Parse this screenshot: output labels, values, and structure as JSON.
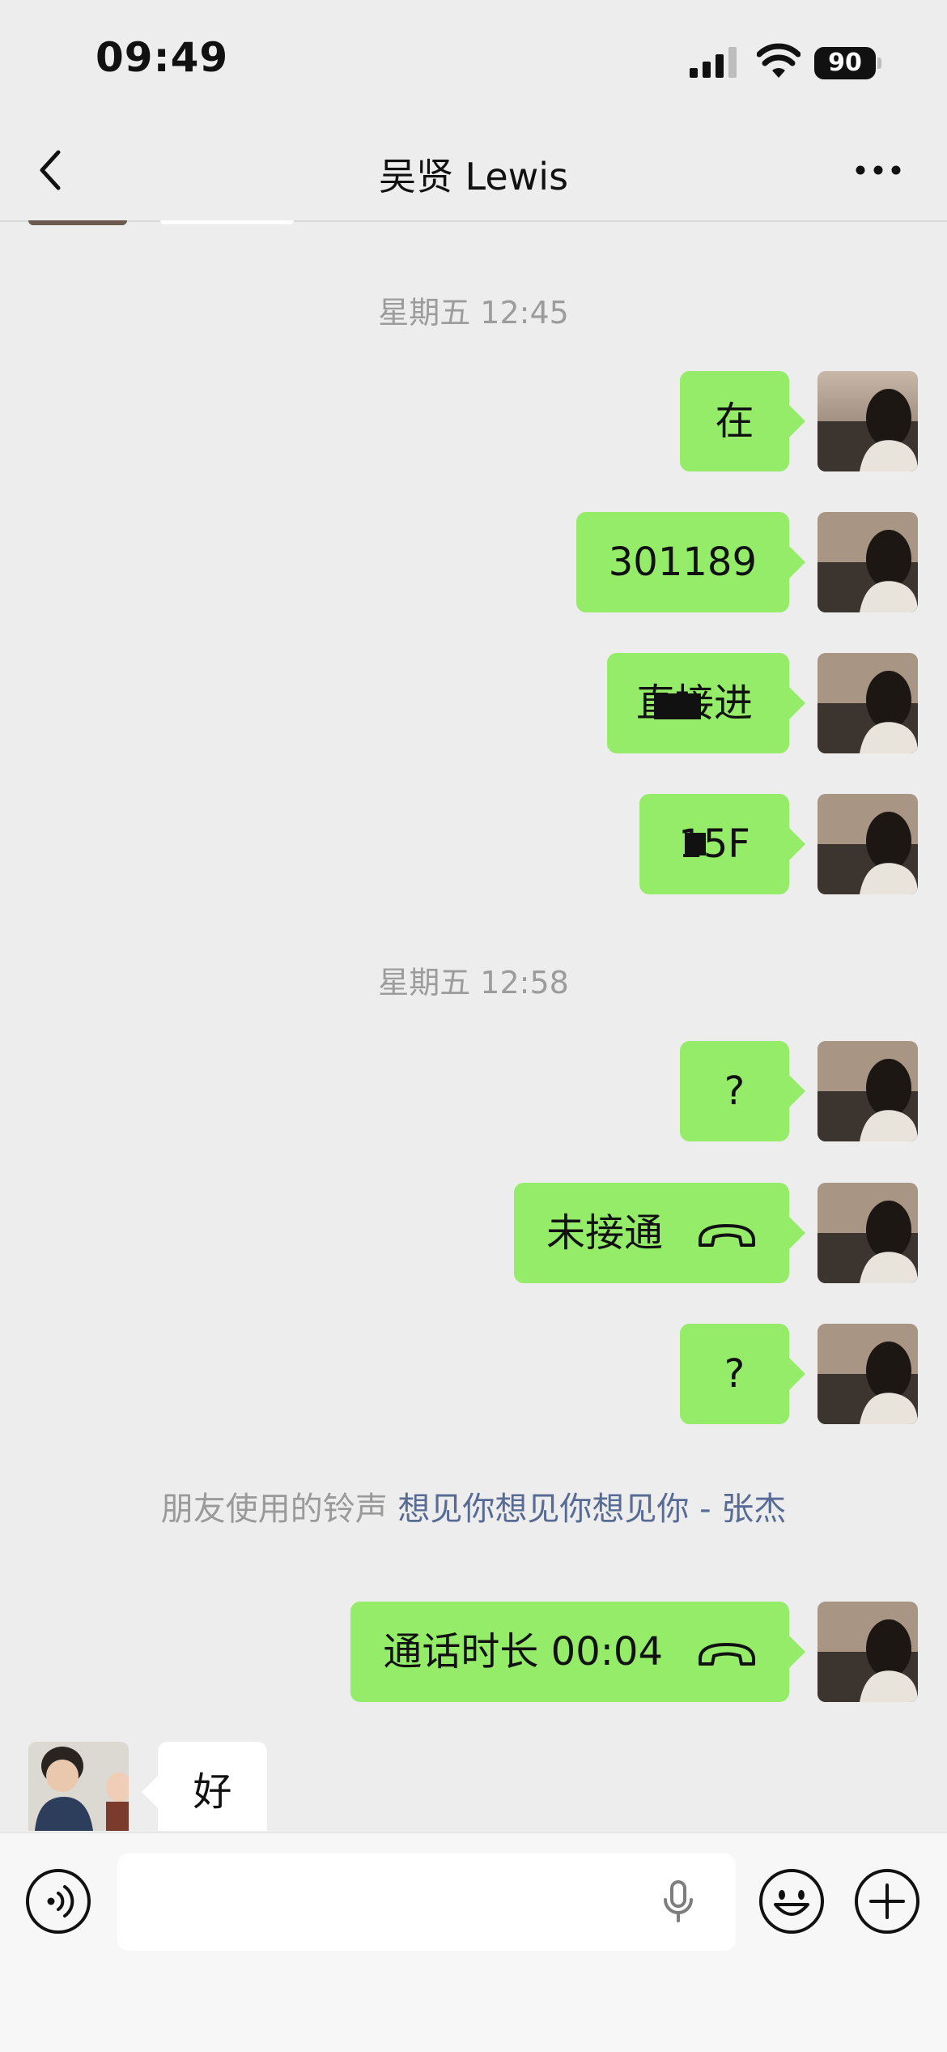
{
  "status_bar": {
    "time": "09:49",
    "battery": "90"
  },
  "header": {
    "title": "吴贤 Lewis"
  },
  "timestamps": [
    "星期五 12:45",
    "星期五 12:58"
  ],
  "messages": [
    {
      "text": "在"
    },
    {
      "text": "301189"
    },
    {
      "text": "直接进"
    },
    {
      "text": "15F"
    },
    {
      "text": "?"
    },
    {
      "text": "未接通"
    },
    {
      "text": "?"
    },
    {
      "text": "通话时长 00:04"
    }
  ],
  "ringtone": {
    "prefix": "朋友使用的铃声",
    "song": "想见你想见你想见你 - 张杰"
  },
  "incoming": {
    "text": "好"
  },
  "input": {
    "placeholder": ""
  },
  "colors": {
    "outgoing_bubble": "#95ec69",
    "background": "#ededed",
    "link": "#576b95"
  },
  "icons": [
    "back-icon",
    "more-icon",
    "call-icon",
    "voice-icon",
    "mic-icon",
    "emoji-icon",
    "plus-icon"
  ]
}
